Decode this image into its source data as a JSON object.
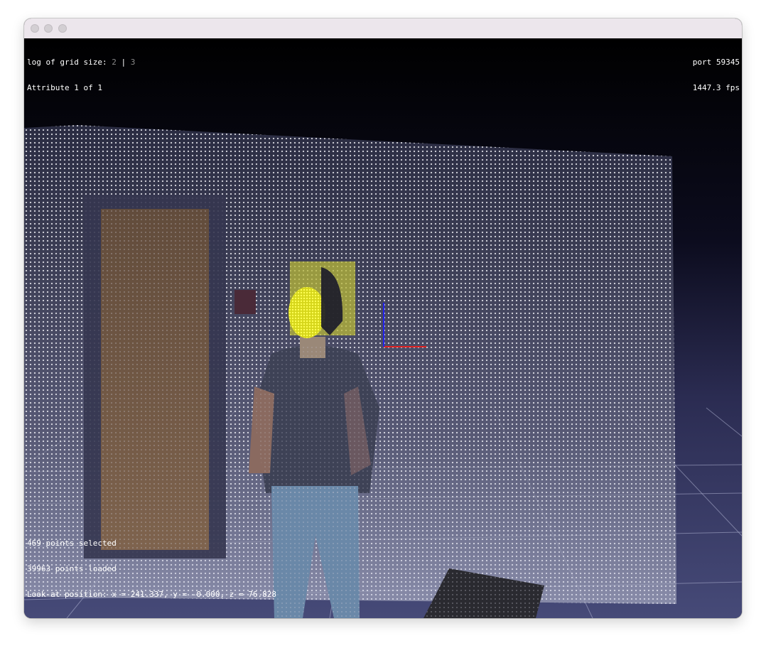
{
  "window": {
    "traffic_lights": [
      "close-button",
      "minimize-button",
      "zoom-button"
    ]
  },
  "hud": {
    "grid_label": "log of grid size:",
    "grid_option_a": "2",
    "grid_separator": "|",
    "grid_option_b": "3",
    "attribute": "Attribute 1 of 1",
    "port": "port 59345",
    "fps": "1447.3 fps",
    "selected": "469 points selected",
    "loaded": "39963 points loaded",
    "lookat": "Look-at position: x = 241.337, y = -0.000, z = 76.828"
  },
  "colors": {
    "background_top": "#000000",
    "background_bottom": "#3c3e6e",
    "wall_points": "#e8e8f0",
    "selection": "#ffff33",
    "axis_x": "#dd2222",
    "axis_y": "#2222ee",
    "grid": "#b0b4d0"
  }
}
